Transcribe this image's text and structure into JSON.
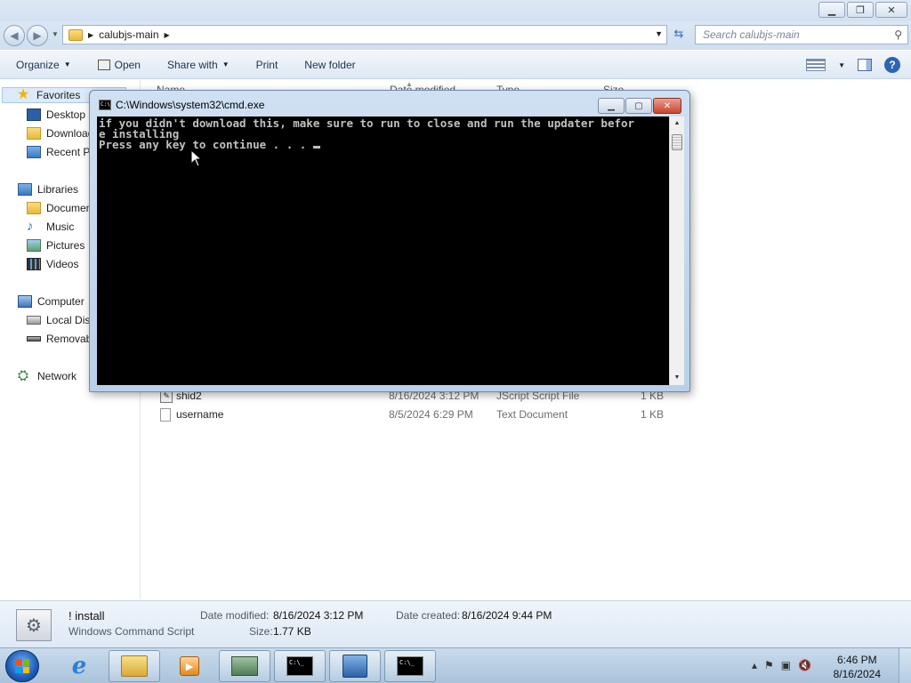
{
  "explorer": {
    "breadcrumb": [
      "calubjs-main"
    ],
    "search_placeholder": "Search calubjs-main",
    "toolbar": {
      "organize": "Organize",
      "open": "Open",
      "share_with": "Share with",
      "print": "Print",
      "new_folder": "New folder"
    },
    "nav": {
      "favorites": "Favorites",
      "desktop": "Desktop",
      "downloads": "Downloads",
      "recent_places": "Recent Places",
      "libraries": "Libraries",
      "documents": "Documents",
      "music": "Music",
      "pictures": "Pictures",
      "videos": "Videos",
      "computer": "Computer",
      "local_disk": "Local Disk",
      "removable": "Removable",
      "network": "Network"
    },
    "columns": {
      "name": "Name",
      "date_modified": "Date modified",
      "type": "Type",
      "size": "Size"
    },
    "files": [
      {
        "name": "shid2",
        "date": "8/16/2024 3:12 PM",
        "type": "JScript Script File",
        "size": "1 KB"
      },
      {
        "name": "username",
        "date": "8/5/2024 6:29 PM",
        "type": "Text Document",
        "size": "1 KB"
      }
    ],
    "details": {
      "name": "! install",
      "type": "Windows Command Script",
      "date_modified_label": "Date modified:",
      "date_modified": "8/16/2024 3:12 PM",
      "size_label": "Size:",
      "size": "1.77 KB",
      "date_created_label": "Date created:",
      "date_created": "8/16/2024 9:44 PM"
    }
  },
  "cmd": {
    "title": "C:\\Windows\\system32\\cmd.exe",
    "lines": [
      "if you didn't download this, make sure to run to close and run the updater befor",
      "e installing",
      "Press any key to continue . . . "
    ]
  },
  "taskbar": {
    "time": "6:46 PM",
    "date": "8/16/2024"
  },
  "icons": {
    "back": "back-arrow-icon",
    "forward": "forward-arrow-icon",
    "search": "search-icon",
    "refresh": "refresh-icon"
  }
}
